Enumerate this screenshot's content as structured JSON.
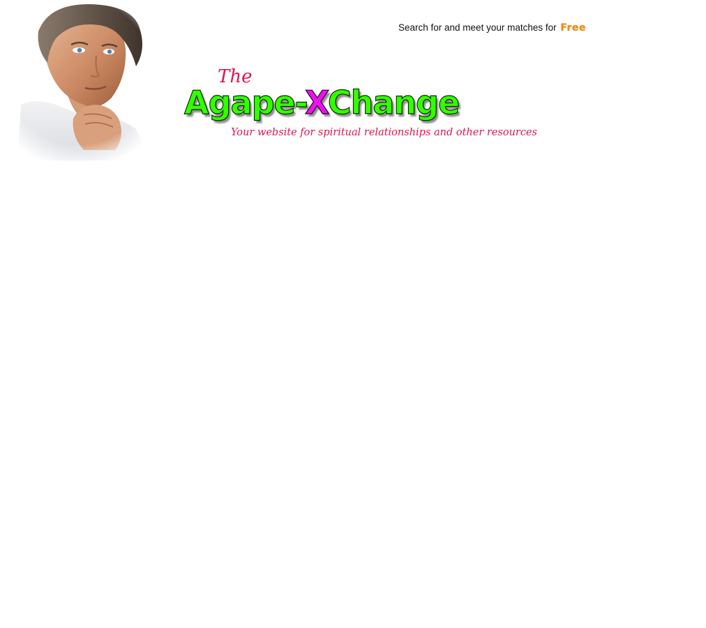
{
  "header": {
    "tagline": "Search for and meet your matches for",
    "tagline_highlight": "Free"
  },
  "logo": {
    "the": "The",
    "name_part1": "Agape-",
    "name_x": "X",
    "name_part2": "Change",
    "subtitle": "Your website for spiritual relationships and  other resources"
  },
  "colors": {
    "background": "#ffffff",
    "logo_green": "#33ff00",
    "logo_magenta": "#ee11ee",
    "logo_red": "#e0144f",
    "free_orange": "#f08a10"
  }
}
